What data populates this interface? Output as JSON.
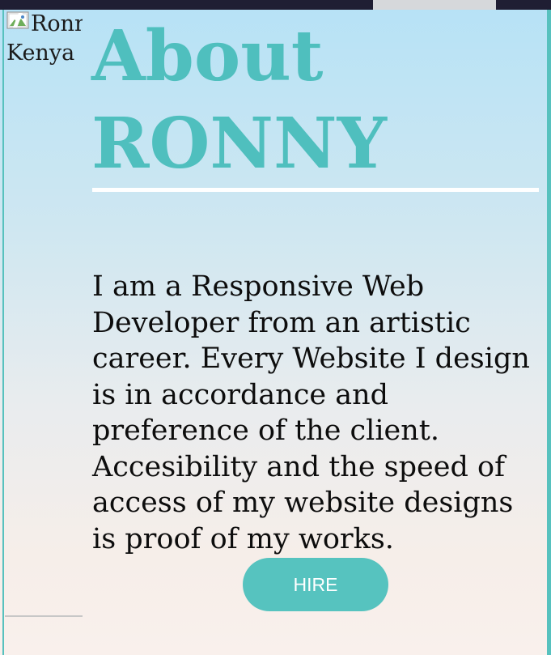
{
  "browser": {
    "chrome_color": "#1f1e33",
    "active_tab_color": "#d6d8db"
  },
  "profile_image": {
    "alt_line1": "Ronny",
    "alt_line2": "Kenya",
    "icon": "broken-image-icon"
  },
  "heading": {
    "title_line1": "About",
    "title_line2": "RONNY",
    "accent_color": "#4fbfbe"
  },
  "bio": {
    "text": "I am a Responsive Web Developer from an artistic career. Every Website I design is in accordance and preference of the client. Accesibility and the speed of access of my website designs is proof of my works."
  },
  "actions": {
    "hire_label": "HIRE",
    "button_color": "#56c3bf"
  }
}
